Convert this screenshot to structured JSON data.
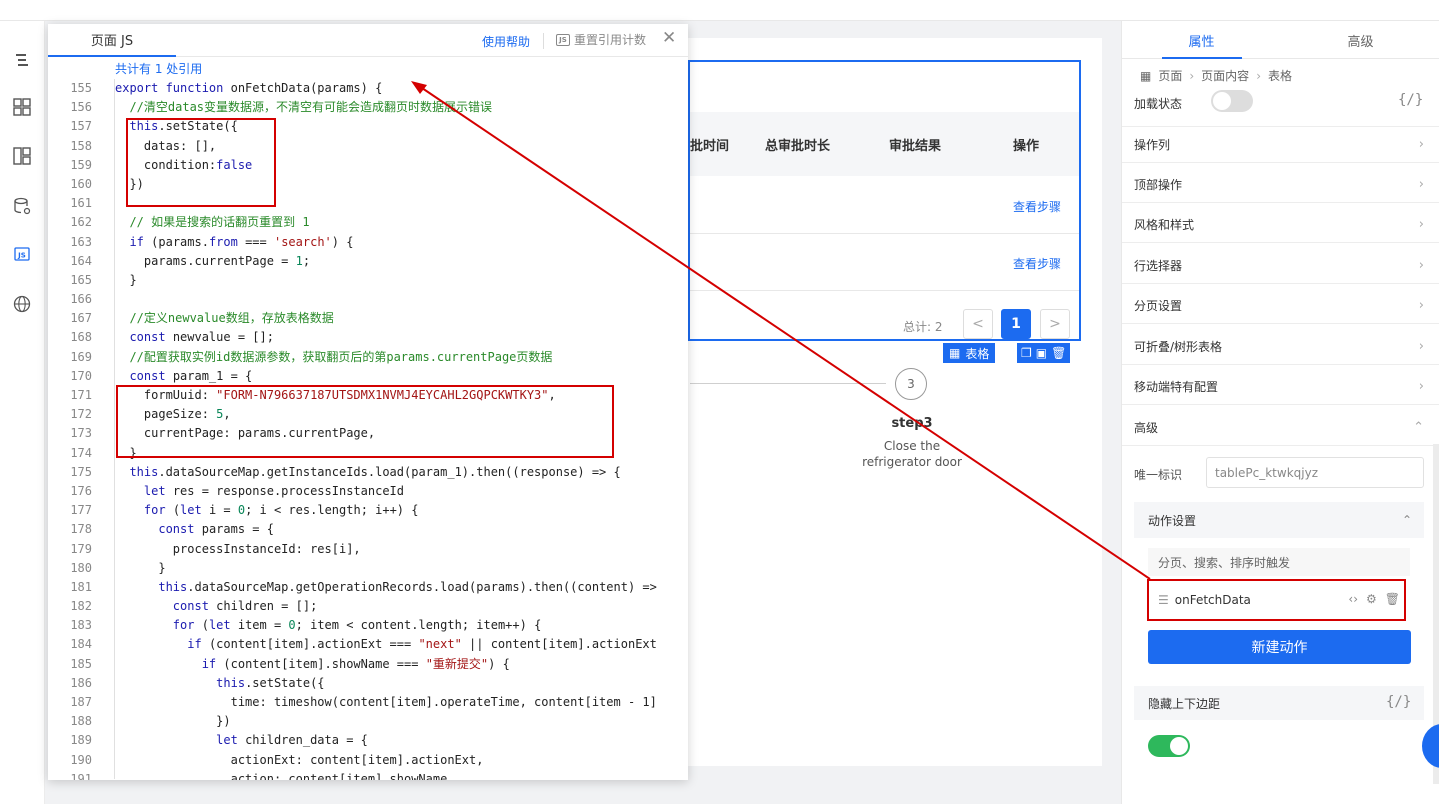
{
  "left_nav": {
    "icons": [
      "outline-list-icon",
      "components-grid-icon",
      "page-layout-icon",
      "data-source-icon",
      "js-icon",
      "globe-icon"
    ]
  },
  "canvas": {
    "columns": [
      "批时间",
      "总审批时长",
      "审批结果",
      "操作"
    ],
    "rows": [
      {
        "action": "查看步骤"
      },
      {
        "action": "查看步骤"
      }
    ],
    "pager": {
      "total": "总计: 2",
      "prev": "<",
      "current": "1",
      "next": ">"
    },
    "table_tag": "表格",
    "step": {
      "number": "3",
      "title": "step3",
      "description": "Close the refrigerator door"
    }
  },
  "js_panel": {
    "tab": "页面 JS",
    "help": "使用帮助",
    "reset": "重置引用计数",
    "js_badge": "JS",
    "close": "✕",
    "ref_count": "共计有 1 处引用",
    "lines": [
      {
        "n": "155",
        "indent": 0,
        "parts": [
          [
            "kw",
            "export function "
          ],
          [
            "plain",
            "onFetchData(params) {"
          ]
        ]
      },
      {
        "n": "156",
        "indent": 1,
        "parts": [
          [
            "cm",
            "//清空datas变量数据源，不清空有可能会造成翻页时数据展示错误"
          ]
        ]
      },
      {
        "n": "157",
        "indent": 1,
        "parts": [
          [
            "kw",
            "this"
          ],
          [
            "plain",
            ".setState({"
          ]
        ]
      },
      {
        "n": "158",
        "indent": 2,
        "parts": [
          [
            "plain",
            "datas: [],"
          ]
        ]
      },
      {
        "n": "159",
        "indent": 2,
        "parts": [
          [
            "plain",
            "condition:"
          ],
          [
            "kw",
            "false"
          ]
        ]
      },
      {
        "n": "160",
        "indent": 1,
        "parts": [
          [
            "plain",
            "})"
          ]
        ]
      },
      {
        "n": "161",
        "indent": 0,
        "parts": []
      },
      {
        "n": "162",
        "indent": 1,
        "parts": [
          [
            "cm",
            "// 如果是搜索的话翻页重置到 1"
          ]
        ]
      },
      {
        "n": "163",
        "indent": 1,
        "parts": [
          [
            "kw",
            "if "
          ],
          [
            "plain",
            "(params."
          ],
          [
            "kw",
            "from"
          ],
          [
            "plain",
            " === "
          ],
          [
            "str",
            "'search'"
          ],
          [
            "plain",
            ") {"
          ]
        ]
      },
      {
        "n": "164",
        "indent": 2,
        "parts": [
          [
            "plain",
            "params.currentPage = "
          ],
          [
            "num",
            "1"
          ],
          [
            "plain",
            ";"
          ]
        ]
      },
      {
        "n": "165",
        "indent": 1,
        "parts": [
          [
            "plain",
            "}"
          ]
        ]
      },
      {
        "n": "166",
        "indent": 0,
        "parts": []
      },
      {
        "n": "167",
        "indent": 1,
        "parts": [
          [
            "cm",
            "//定义newvalue数组，存放表格数据"
          ]
        ]
      },
      {
        "n": "168",
        "indent": 1,
        "parts": [
          [
            "kw",
            "const "
          ],
          [
            "plain",
            "newvalue = [];"
          ]
        ]
      },
      {
        "n": "169",
        "indent": 1,
        "parts": [
          [
            "cm",
            "//配置获取实例id数据源参数，获取翻页后的第params.currentPage页数据"
          ]
        ]
      },
      {
        "n": "170",
        "indent": 1,
        "parts": [
          [
            "kw",
            "const "
          ],
          [
            "plain",
            "param_1 = {"
          ]
        ]
      },
      {
        "n": "171",
        "indent": 2,
        "parts": [
          [
            "plain",
            "formUuid: "
          ],
          [
            "str",
            "\"FORM-N796637187UTSDMX1NVMJ4EYCAHL2GQPCKWTKY3\""
          ],
          [
            "plain",
            ","
          ]
        ]
      },
      {
        "n": "172",
        "indent": 2,
        "parts": [
          [
            "plain",
            "pageSize: "
          ],
          [
            "num",
            "5"
          ],
          [
            "plain",
            ","
          ]
        ]
      },
      {
        "n": "173",
        "indent": 2,
        "parts": [
          [
            "plain",
            "currentPage: params.currentPage,"
          ]
        ]
      },
      {
        "n": "174",
        "indent": 1,
        "parts": [
          [
            "plain",
            "}"
          ]
        ]
      },
      {
        "n": "175",
        "indent": 1,
        "parts": [
          [
            "kw",
            "this"
          ],
          [
            "plain",
            ".dataSourceMap.getInstanceIds.load(param_1).then((response) => {"
          ]
        ]
      },
      {
        "n": "176",
        "indent": 2,
        "parts": [
          [
            "kw",
            "let "
          ],
          [
            "plain",
            "res = response.processInstanceId"
          ]
        ]
      },
      {
        "n": "177",
        "indent": 2,
        "parts": [
          [
            "kw",
            "for "
          ],
          [
            "plain",
            "("
          ],
          [
            "kw",
            "let "
          ],
          [
            "plain",
            "i = "
          ],
          [
            "num",
            "0"
          ],
          [
            "plain",
            "; i < res.length; i++) {"
          ]
        ]
      },
      {
        "n": "178",
        "indent": 3,
        "parts": [
          [
            "kw",
            "const "
          ],
          [
            "plain",
            "params = {"
          ]
        ]
      },
      {
        "n": "179",
        "indent": 4,
        "parts": [
          [
            "plain",
            "processInstanceId: res[i],"
          ]
        ]
      },
      {
        "n": "180",
        "indent": 3,
        "parts": [
          [
            "plain",
            "}"
          ]
        ]
      },
      {
        "n": "181",
        "indent": 3,
        "parts": [
          [
            "kw",
            "this"
          ],
          [
            "plain",
            ".dataSourceMap.getOperationRecords.load(params).then((content) =>"
          ]
        ]
      },
      {
        "n": "182",
        "indent": 4,
        "parts": [
          [
            "kw",
            "const "
          ],
          [
            "plain",
            "children = [];"
          ]
        ]
      },
      {
        "n": "183",
        "indent": 4,
        "parts": [
          [
            "kw",
            "for "
          ],
          [
            "plain",
            "("
          ],
          [
            "kw",
            "let "
          ],
          [
            "plain",
            "item = "
          ],
          [
            "num",
            "0"
          ],
          [
            "plain",
            "; item < content.length; item++) {"
          ]
        ]
      },
      {
        "n": "184",
        "indent": 5,
        "parts": [
          [
            "kw",
            "if "
          ],
          [
            "plain",
            "(content[item].actionExt === "
          ],
          [
            "str",
            "\"next\""
          ],
          [
            "plain",
            " || content[item].actionExt"
          ]
        ]
      },
      {
        "n": "185",
        "indent": 6,
        "parts": [
          [
            "kw",
            "if "
          ],
          [
            "plain",
            "(content[item].showName === "
          ],
          [
            "str",
            "\"重新提交\""
          ],
          [
            "plain",
            ") {"
          ]
        ]
      },
      {
        "n": "186",
        "indent": 7,
        "parts": [
          [
            "kw",
            "this"
          ],
          [
            "plain",
            ".setState({"
          ]
        ]
      },
      {
        "n": "187",
        "indent": 8,
        "parts": [
          [
            "plain",
            "time: timeshow(content[item].operateTime, content[item - 1]"
          ]
        ]
      },
      {
        "n": "188",
        "indent": 7,
        "parts": [
          [
            "plain",
            "})"
          ]
        ]
      },
      {
        "n": "189",
        "indent": 7,
        "parts": [
          [
            "kw",
            "let "
          ],
          [
            "plain",
            "children_data = {"
          ]
        ]
      },
      {
        "n": "190",
        "indent": 8,
        "parts": [
          [
            "plain",
            "actionExt: content[item].actionExt,"
          ]
        ]
      },
      {
        "n": "191",
        "indent": 8,
        "parts": [
          [
            "plain",
            "action: content[item].showName,"
          ]
        ]
      }
    ]
  },
  "right_panel": {
    "tabs": [
      "属性",
      "高级"
    ],
    "breadcrumb": [
      "页面",
      "页面内容",
      "表格"
    ],
    "loading_state": "加载状态",
    "curly": "{/}",
    "sections": [
      "操作列",
      "顶部操作",
      "风格和样式",
      "行选择器",
      "分页设置",
      "可折叠/树形表格",
      "移动端特有配置",
      "高级"
    ],
    "uid_label": "唯一标识",
    "uid_value": "tablePc_ktwkqjyz",
    "action_settings": "动作设置",
    "trigger_text": "分页、搜索、排序时触发",
    "action_name": "onFetchData",
    "new_action": "新建动作",
    "hide_margin": "隐藏上下边距",
    "colors": {
      "accent": "#1c6bf0",
      "toggle_on": "#2eb85c",
      "highlight": "#d40000"
    }
  }
}
